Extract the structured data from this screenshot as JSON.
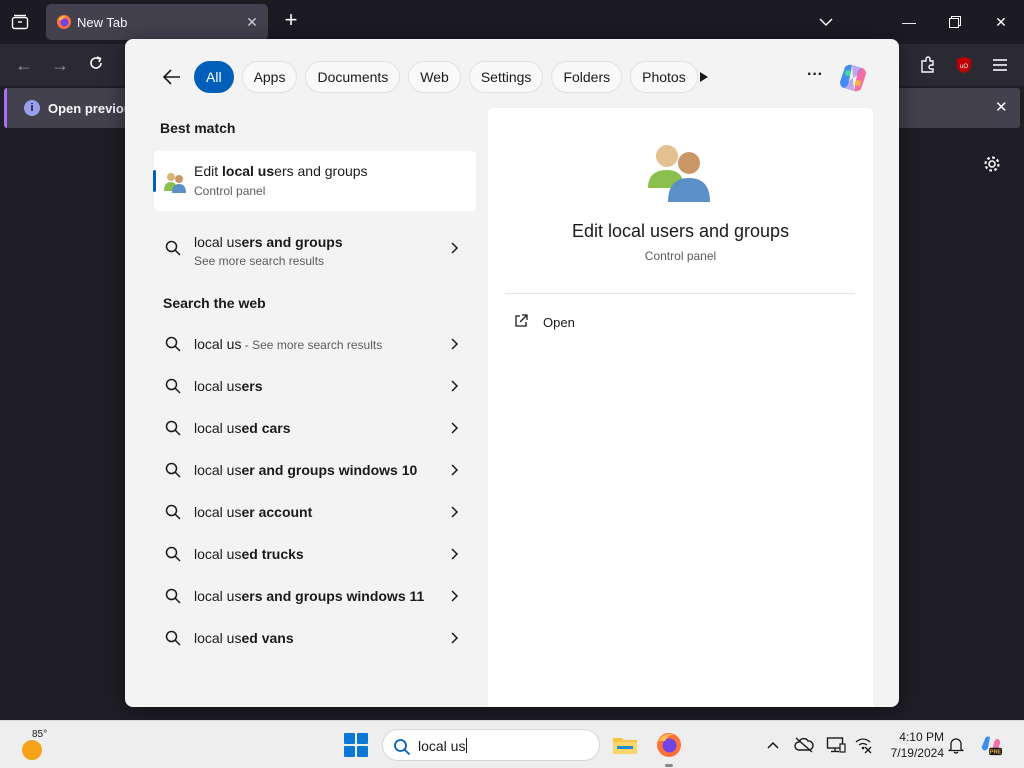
{
  "browser": {
    "tab_title": "New Tab",
    "infobar_message": "Open previous"
  },
  "search_panel": {
    "filters": [
      "All",
      "Apps",
      "Documents",
      "Web",
      "Settings",
      "Folders",
      "Photos"
    ],
    "active_filter": "All",
    "best_match_heading": "Best match",
    "best_match": {
      "name_prefix": "Edit ",
      "name_bold": "local us",
      "name_suffix": "ers and groups",
      "subtitle": "Control panel",
      "icon": "users-group-icon"
    },
    "more_results": {
      "label_plain": "local us",
      "label_bold": "ers and groups",
      "subtitle": "See more search results"
    },
    "web_heading": "Search the web",
    "web_results": [
      {
        "plain": "local us",
        "bold": "",
        "suffix": " - See more search results"
      },
      {
        "plain": "local us",
        "bold": "ers",
        "suffix": ""
      },
      {
        "plain": "local us",
        "bold": "ed cars",
        "suffix": ""
      },
      {
        "plain": "local us",
        "bold": "er and groups windows 10",
        "suffix": ""
      },
      {
        "plain": "local us",
        "bold": "er account",
        "suffix": ""
      },
      {
        "plain": "local us",
        "bold": "ed trucks",
        "suffix": ""
      },
      {
        "plain": "local us",
        "bold": "ers and groups windows 11",
        "suffix": ""
      },
      {
        "plain": "local us",
        "bold": "ed vans",
        "suffix": ""
      }
    ],
    "detail": {
      "name": "Edit local users and groups",
      "subtitle": "Control panel",
      "actions": [
        {
          "label": "Open",
          "icon": "open-external-icon"
        }
      ]
    }
  },
  "taskbar": {
    "weather_temp": "85°",
    "search_value": "local us",
    "time": "4:10 PM",
    "date": "7/19/2024"
  },
  "colors": {
    "accent": "#005fb8",
    "browser_bg": "#1f1e25",
    "panel_bg": "#f3f3f3"
  }
}
